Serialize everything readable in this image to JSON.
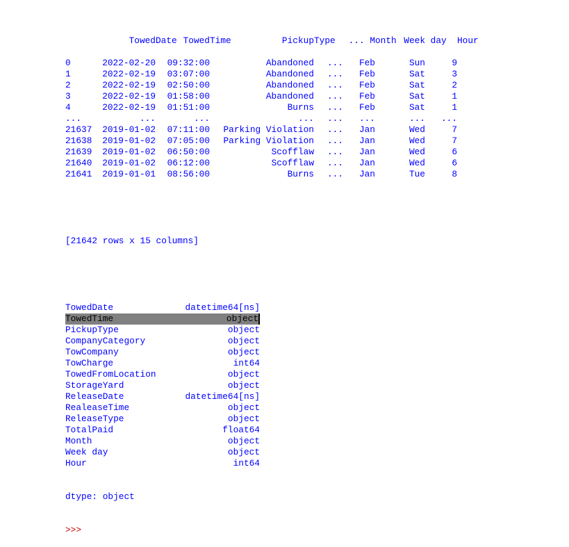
{
  "dataframe": {
    "columns": [
      "",
      "TowedDate",
      "TowedTime",
      "PickupType",
      "...",
      "Month",
      "Week day",
      "Hour"
    ],
    "rows": [
      [
        "0",
        "2022-02-20",
        "09:32:00",
        "Abandoned",
        "...",
        "Feb",
        "Sun",
        "9"
      ],
      [
        "1",
        "2022-02-19",
        "03:07:00",
        "Abandoned",
        "...",
        "Feb",
        "Sat",
        "3"
      ],
      [
        "2",
        "2022-02-19",
        "02:50:00",
        "Abandoned",
        "...",
        "Feb",
        "Sat",
        "2"
      ],
      [
        "3",
        "2022-02-19",
        "01:58:00",
        "Abandoned",
        "...",
        "Feb",
        "Sat",
        "1"
      ],
      [
        "4",
        "2022-02-19",
        "01:51:00",
        "Burns",
        "...",
        "Feb",
        "Sat",
        "1"
      ],
      [
        "...",
        "...",
        "...",
        "...",
        "...",
        "...",
        "...",
        "..."
      ],
      [
        "21637",
        "2019-01-02",
        "07:11:00",
        "Parking Violation",
        "...",
        "Jan",
        "Wed",
        "7"
      ],
      [
        "21638",
        "2019-01-02",
        "07:05:00",
        "Parking Violation",
        "...",
        "Jan",
        "Wed",
        "7"
      ],
      [
        "21639",
        "2019-01-02",
        "06:50:00",
        "Scofflaw",
        "...",
        "Jan",
        "Wed",
        "6"
      ],
      [
        "21640",
        "2019-01-02",
        "06:12:00",
        "Scofflaw",
        "...",
        "Jan",
        "Wed",
        "6"
      ],
      [
        "21641",
        "2019-01-01",
        "08:56:00",
        "Burns",
        "...",
        "Jan",
        "Tue",
        "8"
      ]
    ],
    "shape_text": "[21642 rows x 15 columns]"
  },
  "dtypes": {
    "items": [
      {
        "name": "TowedDate",
        "type": "datetime64[ns]"
      },
      {
        "name": "TowedTime",
        "type": "object",
        "selected": true
      },
      {
        "name": "PickupType",
        "type": "object"
      },
      {
        "name": "CompanyCategory",
        "type": "object"
      },
      {
        "name": "TowCompany",
        "type": "object"
      },
      {
        "name": "TowCharge",
        "type": "int64"
      },
      {
        "name": "TowedFromLocation",
        "type": "object"
      },
      {
        "name": "StorageYard",
        "type": "object"
      },
      {
        "name": "ReleaseDate",
        "type": "datetime64[ns]"
      },
      {
        "name": "RealeaseTime",
        "type": "object"
      },
      {
        "name": "ReleaseType",
        "type": "object"
      },
      {
        "name": "TotalPaid",
        "type": "float64"
      },
      {
        "name": "Month",
        "type": "object"
      },
      {
        "name": "Week day",
        "type": "object"
      },
      {
        "name": "Hour",
        "type": "int64"
      }
    ],
    "footer": "dtype: object"
  },
  "prompt": ">>>",
  "colors": {
    "output": "#0000ff",
    "prompt": "#c00000",
    "selection": "#808080"
  }
}
